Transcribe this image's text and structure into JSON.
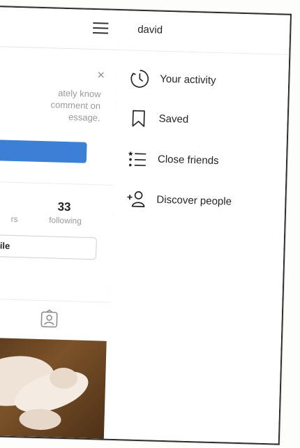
{
  "header": {
    "username": "david"
  },
  "profile": {
    "notice_text": "ately know\ncomment on\nessage.",
    "notice_button_label": "",
    "followers_label": "rs",
    "following_count": "33",
    "following_label": "following",
    "edit_profile_label": "file"
  },
  "menu": {
    "items": [
      {
        "label": "Your activity",
        "icon": "activity-clock-icon"
      },
      {
        "label": "Saved",
        "icon": "bookmark-icon"
      },
      {
        "label": "Close friends",
        "icon": "close-friends-list-icon"
      },
      {
        "label": "Discover people",
        "icon": "add-person-icon"
      }
    ]
  },
  "colors": {
    "accent_blue": "#3b7fd6",
    "text_primary": "#262626",
    "text_muted": "#9a9a9a",
    "divider": "#ececec"
  }
}
